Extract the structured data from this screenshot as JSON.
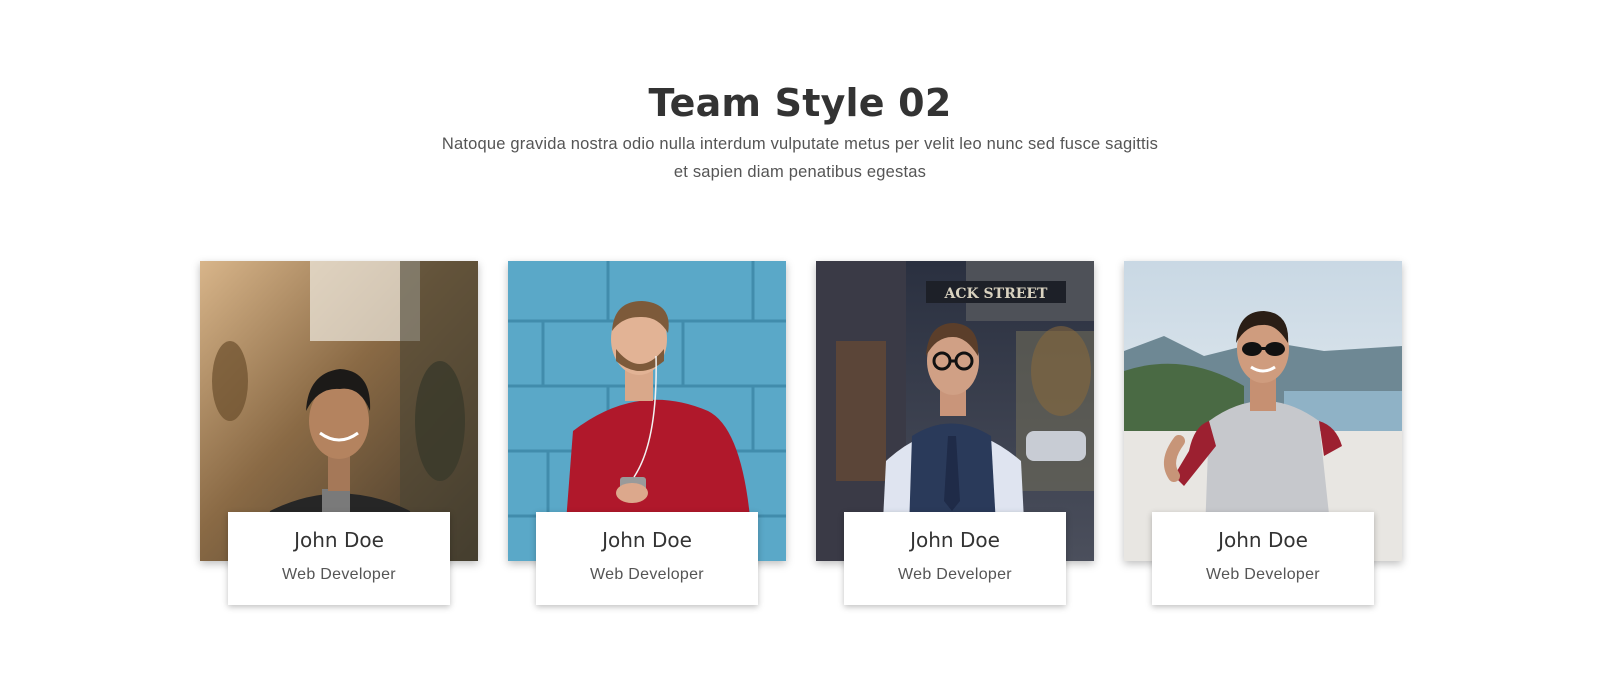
{
  "section": {
    "title": "Team Style 02",
    "description": "Natoque gravida nostra odio nulla interdum vulputate metus per velit leo nunc sed fusce sagittis et sapien diam penatibus egestas"
  },
  "team": [
    {
      "name": "John Doe",
      "role": "Web Developer",
      "photo": "man-smiling-in-field-photo"
    },
    {
      "name": "John Doe",
      "role": "Web Developer",
      "photo": "man-red-sweater-blue-wall-photo"
    },
    {
      "name": "John Doe",
      "role": "Web Developer",
      "photo": "man-vest-street-photo"
    },
    {
      "name": "John Doe",
      "role": "Web Developer",
      "photo": "man-sunglasses-coast-photo"
    }
  ]
}
